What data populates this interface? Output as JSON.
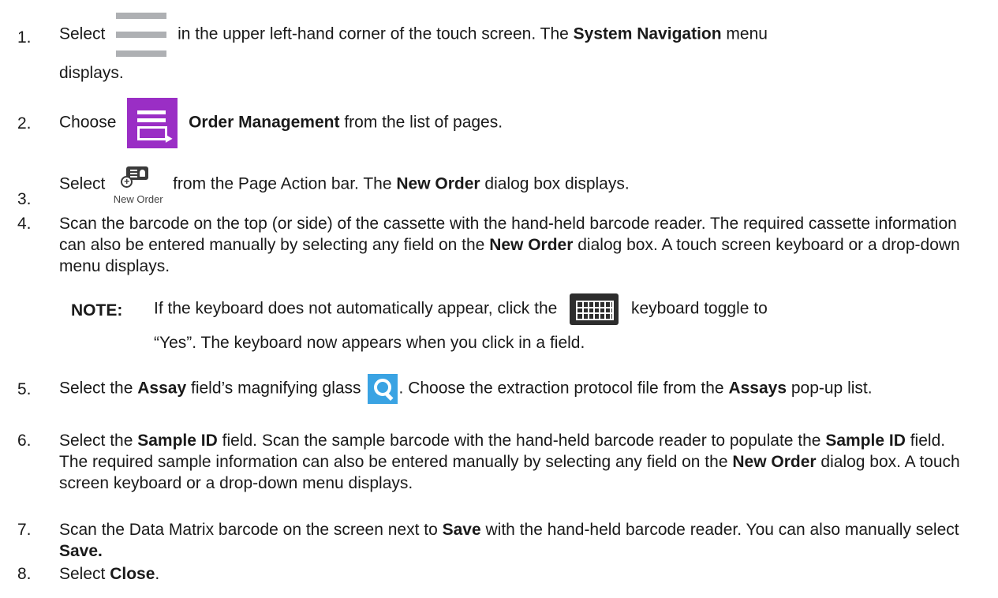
{
  "steps": [
    {
      "num": "1.",
      "t1": "Select",
      "t2": "in the upper left-hand corner of the touch screen. The",
      "b1": "System Navigation",
      "t3": "menu",
      "t4": "displays.",
      "icon": "hamburger-icon"
    },
    {
      "num": "2.",
      "t1": "Choose",
      "b1": "Order Management",
      "t2": "from the list of pages.",
      "icon": "order-management-icon"
    },
    {
      "num": "3.",
      "t1": "Select",
      "icon_label": "New Order",
      "t2": "from the Page Action bar. The",
      "b1": "New Order",
      "t3": "dialog box displays.",
      "icon": "new-order-icon"
    },
    {
      "num": "4.",
      "t1": "Scan the barcode on the top (or side) of the cassette with the hand-held barcode reader. The required cassette information can also be entered manually by selecting any field on the",
      "b1": "New Order",
      "t2": "dialog box. A touch screen keyboard or a drop-down menu displays."
    },
    {
      "num": "5.",
      "t1": "Select the",
      "b1": "Assay",
      "t2": "field’s magnifying glass",
      "t3": ". Choose the extraction protocol file from the",
      "b2": "Assays",
      "t4": "pop-up list.",
      "icon": "magnifier-icon"
    },
    {
      "num": "6.",
      "t1": "Select the",
      "b1": "Sample ID",
      "t2": "field. Scan the sample barcode with the hand-held barcode reader to populate the",
      "b2": "Sample ID",
      "t3": "field. The required sample information can also be entered manually by selecting any field on the",
      "b3": "New Order",
      "t4": "dialog box. A touch screen keyboard or a drop-down menu displays."
    },
    {
      "num": "7.",
      "t1": "Scan the Data Matrix barcode on the screen next to",
      "b1": "Save",
      "t2": "with the hand-held barcode reader. You can also manually select",
      "b2": "Save."
    },
    {
      "num": "8.",
      "t1": "Select",
      "b1": "Close",
      "t2": "."
    }
  ],
  "note": {
    "label": "NOTE:",
    "t1": "If the keyboard does not automatically appear, click the",
    "t2": "keyboard toggle to",
    "t3": "“Yes”. The keyboard now appears when you click in a field.",
    "icon": "keyboard-icon"
  },
  "colors": {
    "purple": "#9a2ec5",
    "blue": "#3aa3e3",
    "gray": "#aeb0b3",
    "dark": "#2d2d2d"
  }
}
